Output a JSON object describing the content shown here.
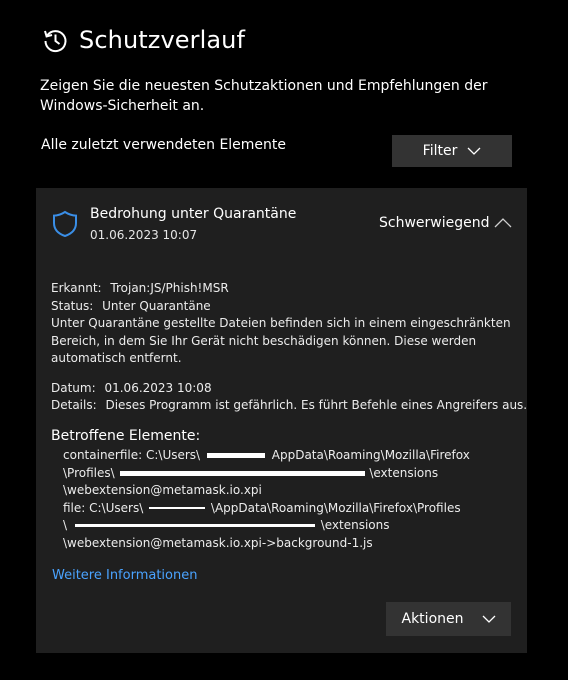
{
  "header": {
    "title": "Schutzverlauf",
    "description": "Zeigen Sie die neuesten Schutzaktionen und Empfehlungen der Windows-Sicherheit an.",
    "icon": "history-icon"
  },
  "toolbar": {
    "recent_label": "Alle zuletzt verwendeten Elemente",
    "filter_label": "Filter"
  },
  "card": {
    "title": "Bedrohung unter Quarantäne",
    "date": "01.06.2023 10:07",
    "severity": "Schwerwiegend",
    "details": {
      "detected_label": "Erkannt:",
      "detected_value": "Trojan:JS/Phish!MSR",
      "status_label": "Status:",
      "status_value": "Unter Quarantäne",
      "status_note": "Unter Quarantäne gestellte Dateien befinden sich in einem eingeschränkten Bereich, in dem Sie Ihr Gerät nicht beschädigen können. Diese werden automatisch entfernt.",
      "date_label": "Datum:",
      "date_value": "01.06.2023 10:08",
      "details_label": "Details:",
      "details_value": "Dieses Programm ist gefährlich. Es führt Befehle eines Angreifers aus."
    },
    "affected_title": "Betroffene Elemente:",
    "affected": {
      "l1_a": "containerfile: C:\\Users\\",
      "l1_b": "AppData\\Roaming\\Mozilla\\Firefox",
      "l2_a": "\\Profiles\\",
      "l2_b": "\\extensions",
      "l3": "\\webextension@metamask.io.xpi",
      "l4_a": "file: C:\\Users\\",
      "l4_b": "\\AppData\\Roaming\\Mozilla\\Firefox\\Profiles",
      "l5_a": "\\",
      "l5_b": "\\extensions",
      "l6": "\\webextension@metamask.io.xpi->background-1.js"
    },
    "more_link": "Weitere Informationen",
    "actions_label": "Aktionen"
  },
  "colors": {
    "background": "#000000",
    "card": "#1f1f1f",
    "button": "#333333",
    "link": "#4aa3ff",
    "shield": "#3a8ee6"
  }
}
